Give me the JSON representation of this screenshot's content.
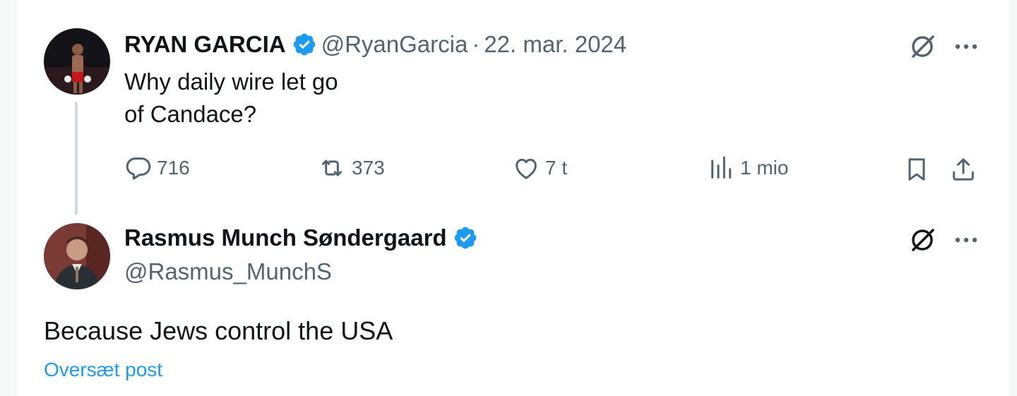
{
  "tweet": {
    "author_name": "RYAN GARCIA",
    "author_handle": "@RyanGarcia",
    "separator": "·",
    "date": "22. mar. 2024",
    "text": "Why daily wire let go\nof Candace?",
    "stats": {
      "replies": "716",
      "reposts": "373",
      "likes": "7 t",
      "views": "1 mio"
    }
  },
  "reply": {
    "author_name": "Rasmus Munch Søndergaard",
    "author_handle": "@Rasmus_MunchS",
    "text": "Because Jews control the USA",
    "translate_label": "Oversæt post"
  },
  "colors": {
    "verified": "#1d9bf0",
    "link": "#1d9bf0",
    "secondary_text": "#536471",
    "primary_text": "#0f1419",
    "thread_line": "#cfd9de"
  },
  "icons": {
    "verified": "verified-badge-icon",
    "grok": "grok-icon",
    "more": "more-icon",
    "reply": "reply-icon",
    "repost": "repost-icon",
    "like": "like-icon",
    "views": "views-icon",
    "bookmark": "bookmark-icon",
    "share": "share-icon"
  }
}
